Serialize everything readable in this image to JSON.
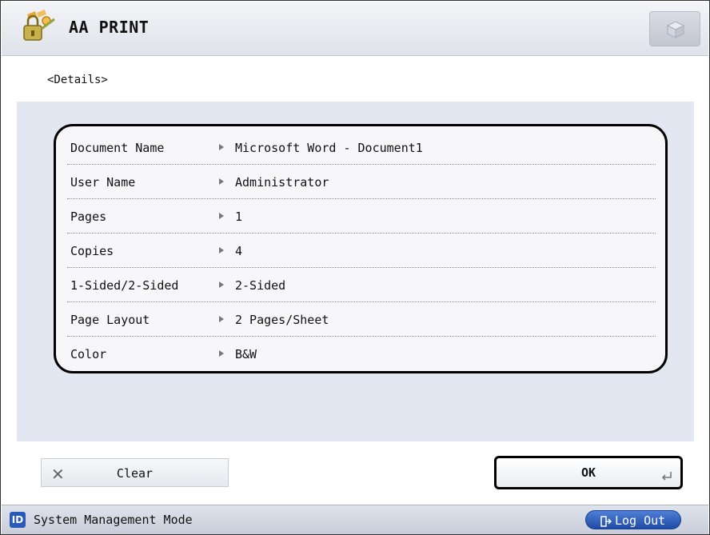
{
  "header": {
    "title": "AA PRINT",
    "app_icon": "key-lock-icon",
    "corner_icon": "box-icon"
  },
  "section_label": "<Details>",
  "details": [
    {
      "label": "Document Name",
      "value": "Microsoft Word - Document1"
    },
    {
      "label": "User Name",
      "value": "Administrator"
    },
    {
      "label": "Pages",
      "value": "1"
    },
    {
      "label": "Copies",
      "value": "4"
    },
    {
      "label": "1-Sided/2-Sided",
      "value": "2-Sided"
    },
    {
      "label": "Page Layout",
      "value": "2 Pages/Sheet"
    },
    {
      "label": "Color",
      "value": "B&W"
    }
  ],
  "buttons": {
    "clear_label": "Clear",
    "ok_label": "OK"
  },
  "status": {
    "id_badge": "ID",
    "mode_text": "System Management Mode",
    "logout_label": "Log Out"
  },
  "colors": {
    "panel_bg": "#e3e7f1",
    "logout_blue": "#2a5ab8"
  }
}
